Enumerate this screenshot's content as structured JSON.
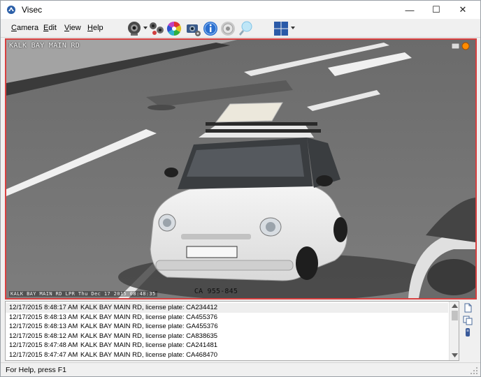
{
  "window": {
    "title": "Visec"
  },
  "window_controls": {
    "minimize": "—",
    "maximize": "☐",
    "close": "✕"
  },
  "menu": {
    "items": [
      "Camera",
      "Edit",
      "View",
      "Help"
    ]
  },
  "toolbar": {
    "icons": [
      "webcam-icon",
      "camera-group-icon",
      "color-wheel-icon",
      "camera-settings-icon",
      "info-icon",
      "target-icon",
      "lightbulb-icon",
      "layout-grid-icon"
    ]
  },
  "video": {
    "camera_label": "KALK BAY MAIN RD",
    "overlay_text": "KALK BAY MAIN RD LPR Thu Dec 17 2015 08:48:35",
    "license_plate": "CA 955-845",
    "border_color": "#d84040",
    "record_indicator_color": "#ff8c00"
  },
  "log": {
    "rows": [
      {
        "time": "12/17/2015 8:48:17 AM",
        "message": "KALK BAY MAIN RD, license plate: CA234412"
      },
      {
        "time": "12/17/2015 8:48:13 AM",
        "message": "KALK BAY MAIN RD, license plate: CA455376"
      },
      {
        "time": "12/17/2015 8:48:13 AM",
        "message": "KALK BAY MAIN RD, license plate: GA455376"
      },
      {
        "time": "12/17/2015 8:48:12 AM",
        "message": "KALK BAY MAIN RD, license plate: CA838635"
      },
      {
        "time": "12/17/2015 8:47:48 AM",
        "message": "KALK BAY MAIN RD, license plate: CA241481"
      },
      {
        "time": "12/17/2015 8:47:47 AM",
        "message": "KALK BAY MAIN RD, license plate: CA468470"
      }
    ]
  },
  "side_icons": [
    "new-document-icon",
    "copy-document-icon",
    "usb-drive-icon"
  ],
  "status": {
    "text": "For Help, press F1"
  }
}
